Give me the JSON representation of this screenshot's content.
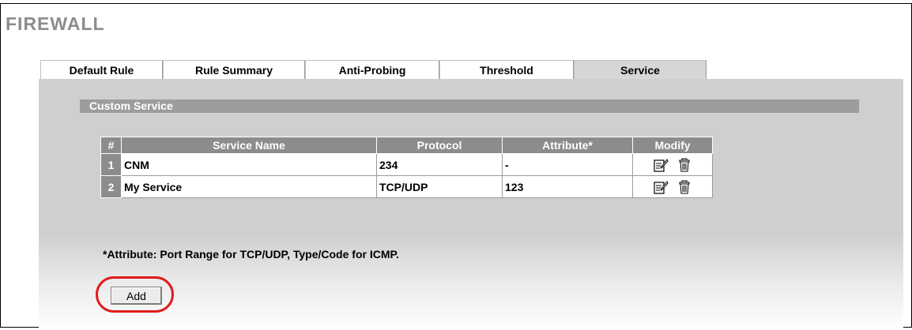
{
  "page": {
    "title": "FIREWALL"
  },
  "tabs": [
    {
      "label": "Default Rule",
      "active": false
    },
    {
      "label": "Rule Summary",
      "active": false
    },
    {
      "label": "Anti-Probing",
      "active": false
    },
    {
      "label": "Threshold",
      "active": false
    },
    {
      "label": "Service",
      "active": true
    }
  ],
  "section": {
    "title": "Custom Service"
  },
  "table": {
    "headers": {
      "num": "#",
      "name": "Service Name",
      "protocol": "Protocol",
      "attribute": "Attribute*",
      "modify": "Modify"
    },
    "rows": [
      {
        "num": "1",
        "name": "CNM",
        "protocol": "234",
        "attribute": "-"
      },
      {
        "num": "2",
        "name": "My Service",
        "protocol": "TCP/UDP",
        "attribute": "123"
      }
    ]
  },
  "footnote": "*Attribute: Port Range for TCP/UDP, Type/Code for ICMP.",
  "add_button": {
    "label": "Add"
  },
  "icons": {
    "edit": "edit-icon",
    "delete": "trash-icon"
  },
  "colors": {
    "tab_active": "#d6d6d6",
    "panel": "#cfcfcf",
    "header": "#8c8c8c",
    "highlight": "#e01b1b"
  }
}
